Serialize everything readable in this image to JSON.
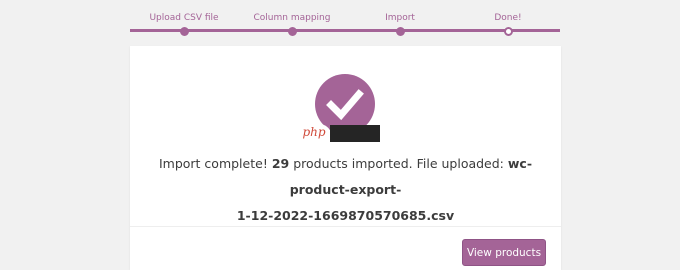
{
  "accent_color": "#a46497",
  "steps": [
    {
      "label": "Upload CSV file",
      "state": "done"
    },
    {
      "label": "Column mapping",
      "state": "done"
    },
    {
      "label": "Import",
      "state": "done"
    },
    {
      "label": "Done!",
      "state": "active"
    }
  ],
  "status_icon": "checkmark-icon",
  "watermark_text": "php",
  "message": {
    "prefix": "Import complete! ",
    "count": "29",
    "middle": " products imported. File uploaded: ",
    "filename_line1": "wc-product-export-",
    "filename_line2": "1-12-2022-1669870570685.csv"
  },
  "view_products_button": "View products"
}
